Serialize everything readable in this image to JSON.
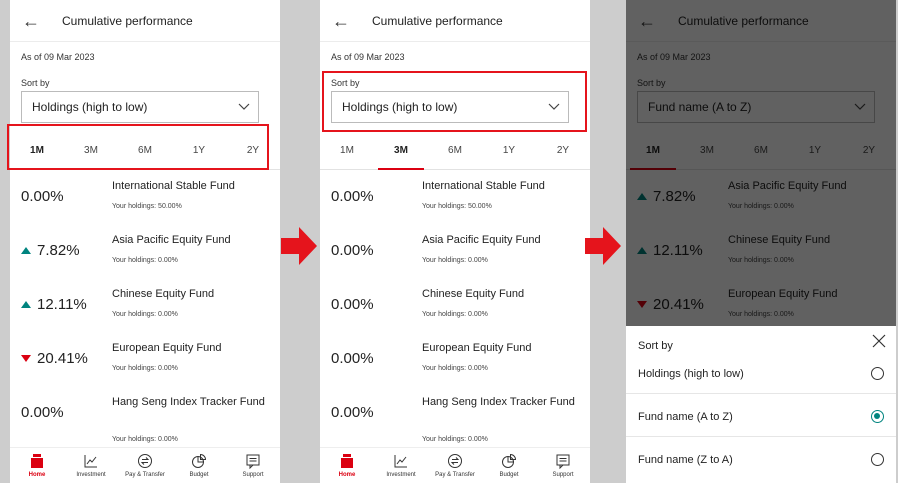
{
  "header_title": "Cumulative performance",
  "as_of": "As of 09 Mar 2023",
  "sort_by_label": "Sort by",
  "tabs": [
    "1M",
    "3M",
    "6M",
    "1Y",
    "2Y"
  ],
  "screens": [
    {
      "sort_value": "Holdings (high to low)",
      "active_tab": "1M",
      "funds": [
        {
          "pct": "0.00%",
          "dir": "none",
          "name": "International Stable Fund",
          "holdings": "Your holdings: 50.00%"
        },
        {
          "pct": "7.82%",
          "dir": "up",
          "name": "Asia Pacific Equity Fund",
          "holdings": "Your holdings: 0.00%"
        },
        {
          "pct": "12.11%",
          "dir": "up",
          "name": "Chinese Equity Fund",
          "holdings": "Your holdings: 0.00%"
        },
        {
          "pct": "20.41%",
          "dir": "down",
          "name": "European Equity Fund",
          "holdings": "Your holdings: 0.00%"
        },
        {
          "pct": "0.00%",
          "dir": "none",
          "name": "Hang Seng Index Tracker Fund",
          "holdings": "Your holdings: 0.00%"
        }
      ]
    },
    {
      "sort_value": "Holdings (high to low)",
      "active_tab": "3M",
      "funds": [
        {
          "pct": "0.00%",
          "dir": "none",
          "name": "International Stable Fund",
          "holdings": "Your holdings: 50.00%"
        },
        {
          "pct": "0.00%",
          "dir": "none",
          "name": "Asia Pacific Equity Fund",
          "holdings": "Your holdings: 0.00%"
        },
        {
          "pct": "0.00%",
          "dir": "none",
          "name": "Chinese Equity Fund",
          "holdings": "Your holdings: 0.00%"
        },
        {
          "pct": "0.00%",
          "dir": "none",
          "name": "European Equity Fund",
          "holdings": "Your holdings: 0.00%"
        },
        {
          "pct": "0.00%",
          "dir": "none",
          "name": "Hang Seng Index Tracker Fund",
          "holdings": "Your holdings: 0.00%"
        }
      ]
    },
    {
      "sort_value": "Fund name (A to Z)",
      "active_tab": "1M",
      "funds": [
        {
          "pct": "7.82%",
          "dir": "up",
          "name": "Asia Pacific Equity Fund",
          "holdings": "Your holdings: 0.00%"
        },
        {
          "pct": "12.11%",
          "dir": "up",
          "name": "Chinese Equity Fund",
          "holdings": "Your holdings: 0.00%"
        },
        {
          "pct": "20.41%",
          "dir": "down",
          "name": "European Equity Fund",
          "holdings": "Your holdings: 0.00%"
        }
      ]
    }
  ],
  "bottom_nav": [
    {
      "label": "Home",
      "icon": "home-icon",
      "active": true
    },
    {
      "label": "Investment",
      "icon": "chart-icon",
      "active": false
    },
    {
      "label": "Pay & Transfer",
      "icon": "transfer-icon",
      "active": false
    },
    {
      "label": "Budget",
      "icon": "budget-icon",
      "active": false
    },
    {
      "label": "Support",
      "icon": "support-icon",
      "active": false
    }
  ],
  "sort_sheet": {
    "title": "Sort by",
    "options": [
      {
        "label": "Holdings (high to low)",
        "selected": false
      },
      {
        "label": "Fund name (A to Z)",
        "selected": true
      },
      {
        "label": "Fund name (Z to A)",
        "selected": false
      }
    ]
  },
  "colors": {
    "brand_red": "#db0011",
    "up_green": "#00847f",
    "highlight": "#e5141c"
  }
}
